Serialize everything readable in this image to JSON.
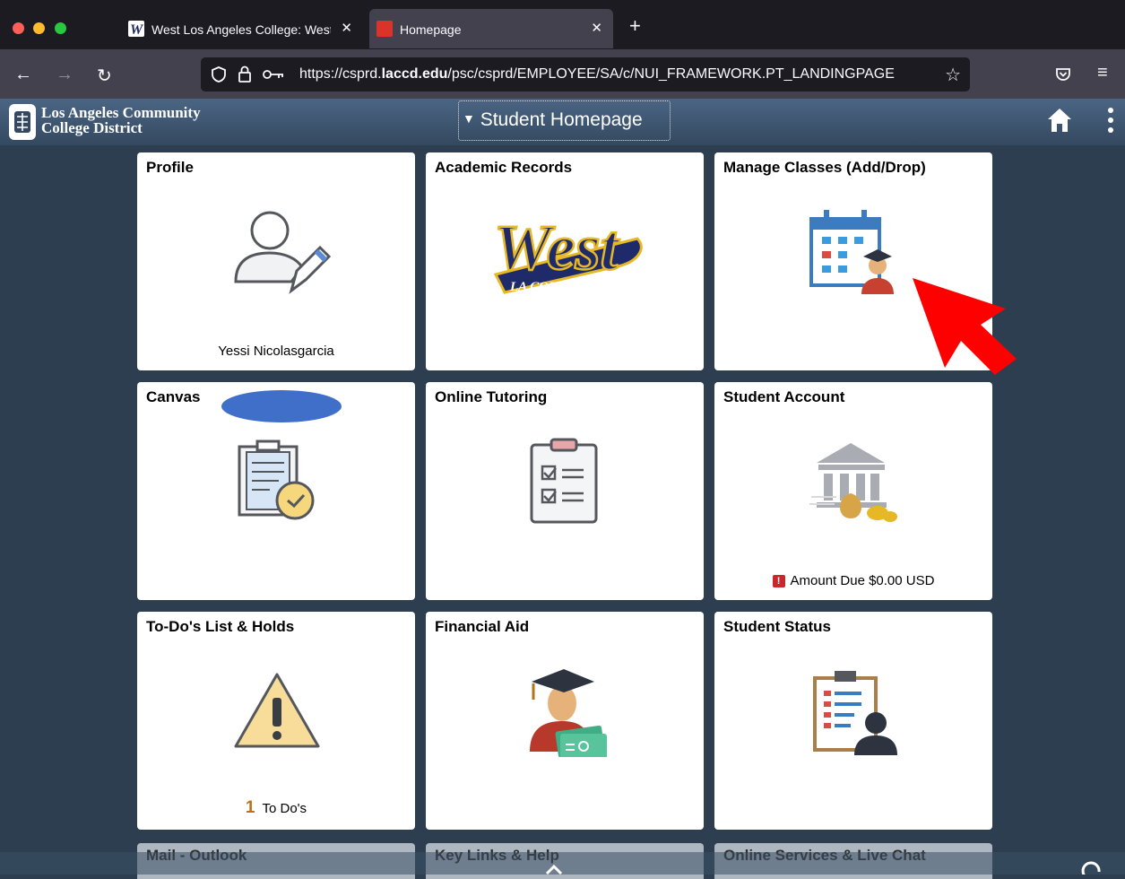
{
  "browser": {
    "tabs": [
      {
        "title": "West Los Angeles College: West",
        "active": false
      },
      {
        "title": "Homepage",
        "active": true
      }
    ],
    "url": {
      "prefix": "https://csprd.",
      "host": "laccd.edu",
      "path": "/psc/csprd/EMPLOYEE/SA/c/NUI_FRAMEWORK.PT_LANDINGPAGE"
    }
  },
  "header": {
    "org_line1": "Los Angeles Community",
    "org_line2": "College District",
    "homepage_selector": "Student Homepage"
  },
  "tiles": [
    {
      "title": "Profile",
      "footer": "Yessi Nicolasgarcia"
    },
    {
      "title": "Academic Records",
      "logo_main": "West",
      "logo_sub": "LA COLLEGE"
    },
    {
      "title": "Manage Classes (Add/Drop)"
    },
    {
      "title": "Canvas"
    },
    {
      "title": "Online Tutoring"
    },
    {
      "title": "Student Account",
      "footer": "Amount Due $0.00 USD",
      "alert_glyph": "!"
    },
    {
      "title": "To-Do's List & Holds",
      "count": "1",
      "footer": "To Do's"
    },
    {
      "title": "Financial Aid"
    },
    {
      "title": "Student Status"
    }
  ],
  "bottom_tiles": [
    "Mail - Outlook",
    "Key Links & Help",
    "Online Services & Live Chat"
  ],
  "colors": {
    "annotation_arrow": "#ff0000",
    "page_bg": "#2c3e50",
    "canvas_redaction": "#3f6fc9"
  }
}
